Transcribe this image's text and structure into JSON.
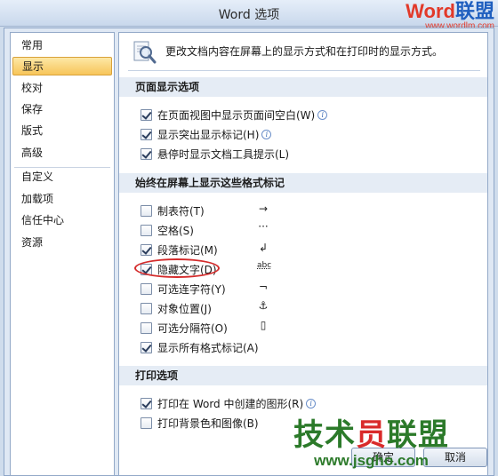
{
  "window": {
    "title": "Word 选项"
  },
  "watermark_top": {
    "brand_a": "Word",
    "brand_b": "联盟",
    "url": "www.wordlm.com"
  },
  "sidebar": {
    "items": [
      {
        "label": "常用"
      },
      {
        "label": "显示",
        "active": true
      },
      {
        "label": "校对"
      },
      {
        "label": "保存"
      },
      {
        "label": "版式"
      },
      {
        "label": "高级"
      },
      {
        "label": "自定义"
      },
      {
        "label": "加载项"
      },
      {
        "label": "信任中心"
      },
      {
        "label": "资源"
      }
    ]
  },
  "header": {
    "description": "更改文档内容在屏幕上的显示方式和在打印时的显示方式。"
  },
  "sections": {
    "page_display": {
      "title": "页面显示选项",
      "options": [
        {
          "label": "在页面视图中显示页面间空白(W)",
          "checked": true,
          "info": true
        },
        {
          "label": "显示突出显示标记(H)",
          "checked": true,
          "info": true
        },
        {
          "label": "悬停时显示文档工具提示(L)",
          "checked": true,
          "info": false
        }
      ]
    },
    "format_marks": {
      "title": "始终在屏幕上显示这些格式标记",
      "options": [
        {
          "label": "制表符(T)",
          "checked": false,
          "glyph": "→"
        },
        {
          "label": "空格(S)",
          "checked": false,
          "glyph": "···"
        },
        {
          "label": "段落标记(M)",
          "checked": true,
          "glyph": "↲"
        },
        {
          "label": "隐藏文字(D)",
          "checked": true,
          "glyph": "abc"
        },
        {
          "label": "可选连字符(Y)",
          "checked": false,
          "glyph": "¬"
        },
        {
          "label": "对象位置(J)",
          "checked": false,
          "glyph": "⚓"
        },
        {
          "label": "可选分隔符(O)",
          "checked": false,
          "glyph": "▯"
        },
        {
          "label": "显示所有格式标记(A)",
          "checked": true,
          "glyph": ""
        }
      ]
    },
    "print": {
      "title": "打印选项",
      "options": [
        {
          "label": "打印在 Word 中创建的图形(R)",
          "checked": true,
          "info": true
        },
        {
          "label": "打印背景色和图像(B)",
          "checked": false,
          "info": false
        }
      ]
    }
  },
  "buttons": {
    "ok": "确定",
    "cancel": "取消"
  },
  "watermark_bottom": {
    "text_a": "技术",
    "text_b": "员",
    "text_c": "联盟",
    "url": "www.jsgho.com"
  },
  "colors": {
    "highlight_ring": "#d42b2b",
    "active_nav": "#f7c55a"
  }
}
